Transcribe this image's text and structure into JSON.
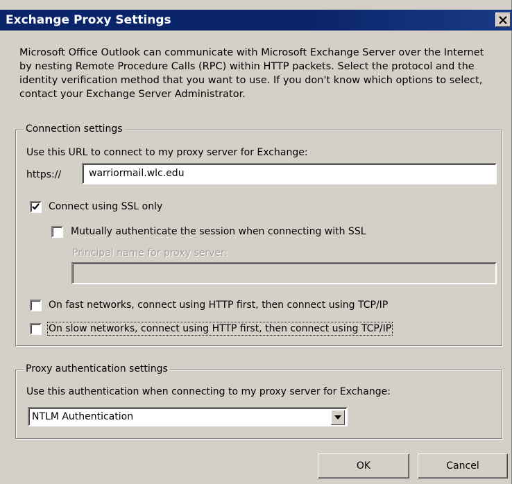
{
  "window": {
    "title": "Exchange Proxy Settings"
  },
  "intro_text": "Microsoft Office Outlook can communicate with Microsoft Exchange Server over the Internet by nesting Remote Procedure Calls (RPC) within HTTP packets.  Select the protocol and the identity verification method that you want to use.  If you don't know which options to select, contact your Exchange Server Administrator.",
  "connection": {
    "legend": "Connection settings",
    "url_label": "Use this URL to connect to my proxy server for Exchange:",
    "url_prefix": "https://",
    "url_value": "warriormail.wlc.edu",
    "ssl_label": "Connect using SSL only",
    "ssl_checked": true,
    "mutual_auth_label": "Mutually authenticate the session when connecting with SSL",
    "mutual_auth_checked": false,
    "principal_label": "Principal name for proxy server:",
    "principal_value": "",
    "fast_label": "On fast networks, connect using HTTP first, then connect using TCP/IP",
    "fast_checked": false,
    "slow_label": "On slow networks, connect using HTTP first, then connect using TCP/IP",
    "slow_checked": false
  },
  "auth": {
    "legend": "Proxy authentication settings",
    "label": "Use this authentication when connecting to my proxy server for Exchange:",
    "selected": "NTLM Authentication"
  },
  "buttons": {
    "ok": "OK",
    "cancel": "Cancel"
  },
  "colors": {
    "titlebar": "#0a246a",
    "face": "#d4d0c8"
  }
}
